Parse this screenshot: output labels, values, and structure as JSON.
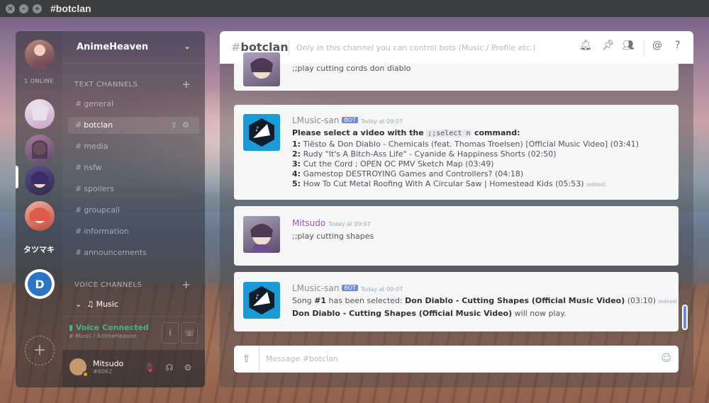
{
  "window": {
    "title": "#botclan"
  },
  "servers": {
    "online_label": "1 ONLINE",
    "tatsumaki_label": "タツマキ"
  },
  "guild": {
    "name": "AnimeHeaven"
  },
  "categories": {
    "text": "TEXT CHANNELS",
    "voice": "VOICE CHANNELS"
  },
  "text_channels": [
    "general",
    "botclan",
    "media",
    "nsfw",
    "spoilers",
    "groupcall",
    "information",
    "announcements"
  ],
  "voice_channel": {
    "name": "Music"
  },
  "voice_connection": {
    "status": "Voice Connected",
    "location": "Music / AnimeHeaven"
  },
  "user": {
    "name": "Mitsudo",
    "tag": "#6062"
  },
  "chat": {
    "channel": "botclan",
    "topic": "Only in this channel you can control bots (Music / Profile etc.)"
  },
  "messages": {
    "m0": {
      "line": ";;play cutting cords don diablo"
    },
    "m1": {
      "author": "LMusic-san",
      "badge": "BOT",
      "time": "Today at 09:07",
      "intro_before": "Please select a video with the",
      "code": ";;select n",
      "intro_after": "command:",
      "options": [
        {
          "n": "1:",
          "text": "Tiësto & Don Diablo - Chemicals (feat. Thomas Troelsen) [Official Music Video] (03:41)"
        },
        {
          "n": "2:",
          "text": "Rudy \"It's A Bitch-Ass Life\" - Cyanide & Happiness Shorts (02:50)"
        },
        {
          "n": "3:",
          "text": "Cut the Cord ; OPEN OC PMV Sketch Map (03:49)"
        },
        {
          "n": "4:",
          "text": "Gamestop DESTROYING Games and Controllers? (04:18)"
        },
        {
          "n": "5:",
          "text": "How To Cut Metal Roofing With A Circular Saw | Homestead Kids (05:53)"
        }
      ],
      "edited": "(edited)"
    },
    "m2": {
      "author": "Mitsudo",
      "time": "Today at 09:07",
      "line": ";;play cutting shapes"
    },
    "m3": {
      "author": "LMusic-san",
      "badge": "BOT",
      "time": "Today at 09:07",
      "l1_prefix": "Song",
      "l1_num": "#1",
      "l1_mid": "has been selected:",
      "l1_title": "Don Diablo - Cutting Shapes (Official Music Video)",
      "l1_dur": "(03:10)",
      "edited": "(edited)",
      "l2_title": "Don Diablo - Cutting Shapes (Official Music Video)",
      "l2_suffix": "will now play."
    }
  },
  "input": {
    "placeholder": "Message #botclan"
  },
  "colors": {
    "accent": "#7289da",
    "voice_green": "#43b581",
    "mention_purple": "#9b59b6"
  }
}
